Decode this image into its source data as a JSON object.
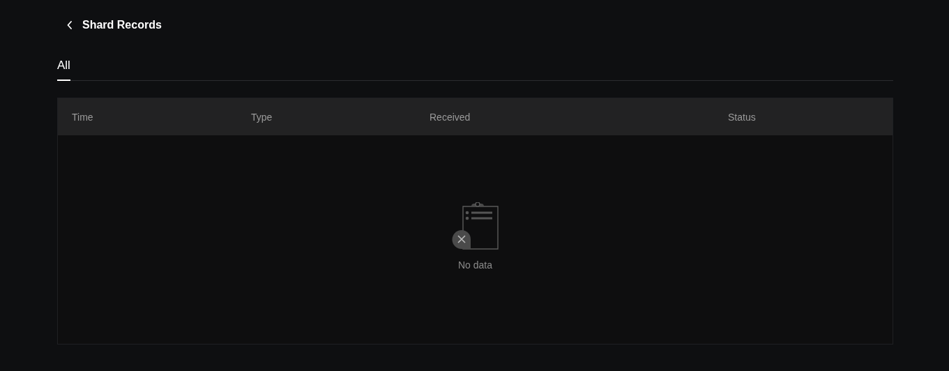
{
  "header": {
    "title": "Shard Records"
  },
  "tabs": [
    {
      "label": "All",
      "selected": true
    }
  ],
  "table": {
    "columns": [
      "Time",
      "Type",
      "Received",
      "Status"
    ],
    "empty_text": "No data"
  }
}
